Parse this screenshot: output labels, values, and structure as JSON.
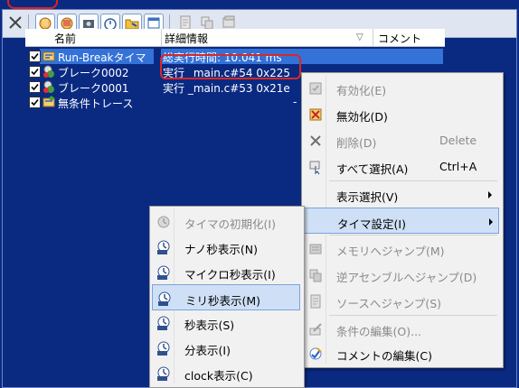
{
  "toolbar": {
    "icons": [
      "close-icon",
      "hand-run-icon",
      "hand-stop-icon",
      "camera-icon",
      "stopwatch-icon",
      "folder-icon",
      "window-icon",
      "document-icon",
      "copy-icon",
      "stack-icon"
    ]
  },
  "columns": {
    "name": "名前",
    "detail": "詳細情報",
    "sort_arrow": "▽",
    "comment": "コメント"
  },
  "rows": [
    {
      "name": "Run-Breakタイマ",
      "detail": "総実行時間: 10.041 ms"
    },
    {
      "name": "ブレーク0002",
      "detail": "実行 _main.c#54 0x225"
    },
    {
      "name": "ブレーク0001",
      "detail": "実行 _main.c#53 0x21e"
    },
    {
      "name": "無条件トレース",
      "detail": "-"
    }
  ],
  "context_menu": {
    "items": [
      {
        "label": "有効化(E)",
        "shortcut": ""
      },
      {
        "label": "無効化(D)",
        "shortcut": ""
      },
      {
        "label": "削除(D)",
        "shortcut": "Delete"
      },
      {
        "label": "すべて選択(A)",
        "shortcut": "Ctrl+A"
      },
      {
        "label": "表示選択(V)",
        "shortcut": ""
      },
      {
        "label": "タイマ設定(I)",
        "shortcut": ""
      },
      {
        "label": "メモリへジャンプ(M)",
        "shortcut": ""
      },
      {
        "label": "逆アセンブルへジャンプ(D)",
        "shortcut": ""
      },
      {
        "label": "ソースへジャンプ(S)",
        "shortcut": ""
      },
      {
        "label": "条件の編集(O)...",
        "shortcut": ""
      },
      {
        "label": "コメントの編集(C)",
        "shortcut": ""
      }
    ]
  },
  "submenu": {
    "items": [
      {
        "label": "タイマの初期化(I)"
      },
      {
        "label": "ナノ秒表示(N)"
      },
      {
        "label": "マイクロ秒表示(I)"
      },
      {
        "label": "ミリ秒表示(M)"
      },
      {
        "label": "秒表示(S)"
      },
      {
        "label": "分表示(I)"
      },
      {
        "label": "clock表示(C)"
      }
    ]
  },
  "colors": {
    "background": "#0a2a82",
    "selection": "#3472d8",
    "highlight_border": "#d82828",
    "menu_hover": "#cfe0f6"
  }
}
